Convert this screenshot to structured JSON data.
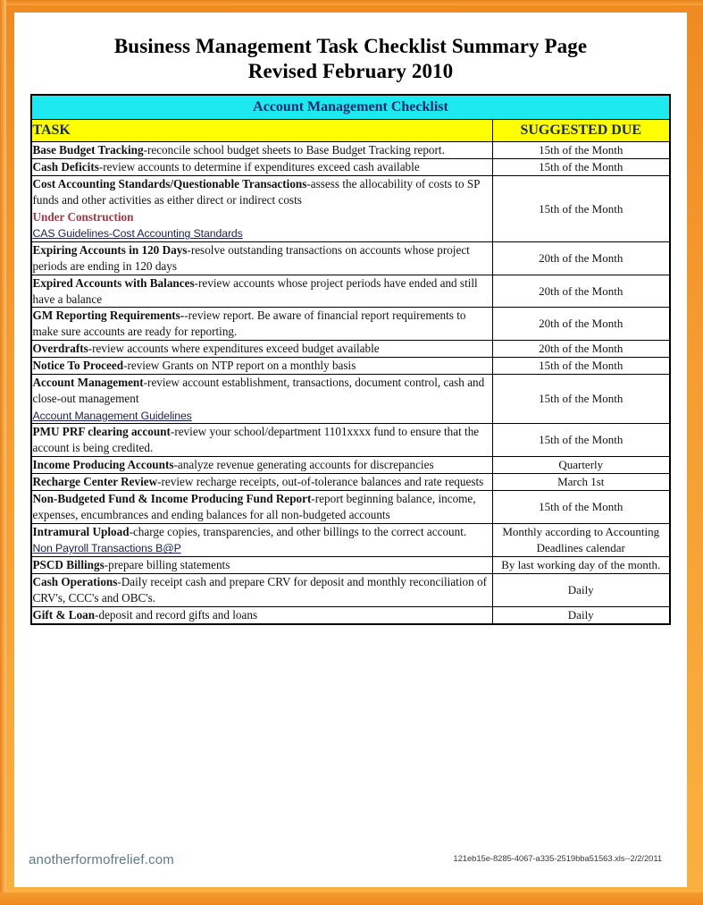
{
  "document": {
    "title_line1": "Business Management Task Checklist Summary Page",
    "title_line2": "Revised February 2010"
  },
  "table": {
    "band_title": "Account Management Checklist",
    "headers": {
      "task": "TASK",
      "due": "SUGGESTED DUE"
    },
    "colors": {
      "band_background": "#1ee8f0",
      "band_text": "#1b2a6b",
      "header_background": "#ffff00",
      "header_text": "#1b2a6b",
      "frame_orange": "#f59a30",
      "link_text": "#17224c",
      "warning_text": "#9e3b44"
    },
    "rows": [
      {
        "name": "Base Budget Tracking",
        "desc": "-reconcile school budget sheets to Base Budget Tracking report.",
        "due": "15th of the Month"
      },
      {
        "name": "Cash Deficits",
        "desc": "-review accounts to determine if expenditures exceed cash available",
        "due": "15th of the Month"
      },
      {
        "name": "Cost Accounting Standards/Questionable Transactions",
        "desc": "-assess the allocability of costs to SP funds and other activities as either direct or indirect costs",
        "notice": "Under Construction",
        "link": "CAS Guidelines-Cost Accounting Standards",
        "due": "15th of the Month"
      },
      {
        "name": "Expiring Accounts in 120 Days",
        "desc": "-resolve outstanding transactions on accounts whose project periods are ending in 120 days",
        "due": "20th of the Month"
      },
      {
        "name": "Expired Accounts with Balances",
        "desc": "-review accounts whose project periods have ended and still have a balance",
        "due": "20th of the Month"
      },
      {
        "name": "GM Reporting Requirements-",
        "desc": "-review report.  Be aware of financial report requirements to make sure accounts are ready for reporting.",
        "due": "20th of the Month"
      },
      {
        "name": "Overdrafts",
        "desc": "-review accounts where expenditures exceed budget available",
        "due": "20th of the Month"
      },
      {
        "name": "Notice To Proceed",
        "desc": "-review Grants on NTP report on a monthly basis",
        "due": "15th of the Month"
      },
      {
        "name": "Account Management",
        "desc": "-review account establishment, transactions, document control, cash and close-out management",
        "link": "Account Management Guidelines",
        "due": "15th of the Month"
      },
      {
        "name": "PMU PRF clearing account",
        "desc": "-review your school/department 1101xxxx fund to ensure that the account is being credited.",
        "due": "15th of the Month"
      },
      {
        "name": "Income Producing Accounts",
        "desc": "-analyze revenue generating accounts for discrepancies",
        "due": "Quarterly"
      },
      {
        "name": "Recharge Center Review",
        "desc": "-review recharge receipts, out-of-tolerance balances and rate requests",
        "due": "March 1st"
      },
      {
        "name": "Non-Budgeted Fund & Income Producing Fund Report",
        "desc": "-report beginning balance, income, expenses, encumbrances and ending balances for all non-budgeted accounts",
        "due": "15th of the Month"
      },
      {
        "name": "Intramural Upload",
        "desc": "-charge copies, transparencies, and other billings to the correct account.",
        "link": "Non Payroll Transactions B@P",
        "due": "Monthly according to Accounting Deadlines calendar"
      },
      {
        "name": "PSCD Billings",
        "desc": "-prepare billing statements",
        "due": "By last working day of the month."
      },
      {
        "name": "Cash Operations",
        "desc": "-Daily receipt cash and prepare CRV for deposit and monthly reconciliation of CRV's, CCC's  and OBC's.",
        "due": "Daily"
      },
      {
        "name": "Gift & Loan",
        "desc": "-deposit and record gifts and loans",
        "due": "Daily"
      }
    ]
  },
  "footer": {
    "watermark": "anotherformofrelief.com",
    "document_id": "121eb15e-8285-4067-a335-2519bba51563.xls--2/2/2011"
  }
}
